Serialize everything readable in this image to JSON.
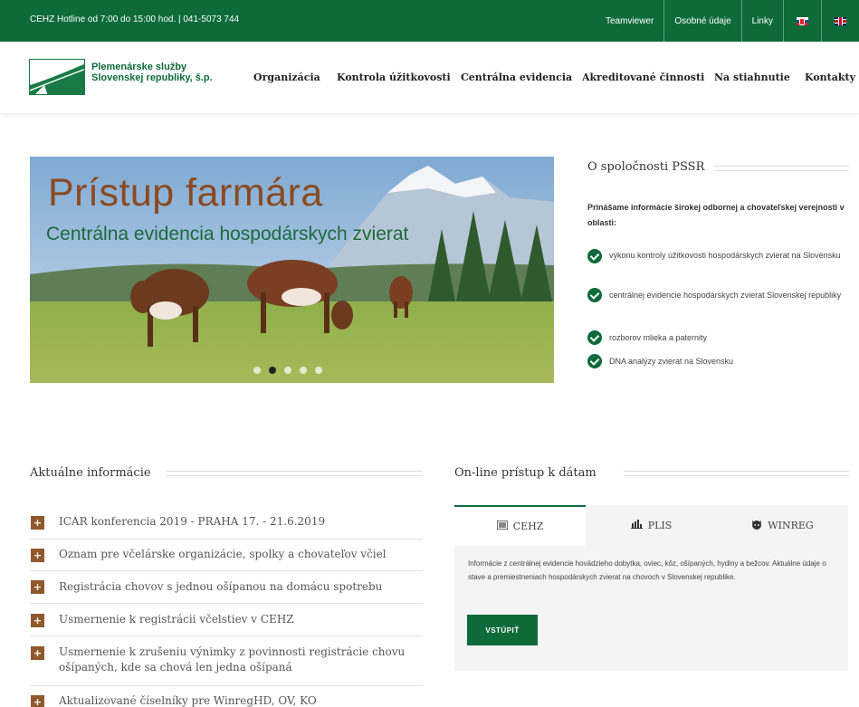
{
  "topbar": {
    "hotline": "CEHZ Hotline od 7:00 do 15:00 hod. | 041-5073 744",
    "links": [
      "Teamviewer",
      "Osobné údaje",
      "Linky"
    ],
    "flags": [
      "flag-sk-icon",
      "flag-gb-icon"
    ]
  },
  "header": {
    "logo_line1": "Plemenárske služby",
    "logo_line2": "Slovenskej republiky, š.p.",
    "nav": [
      "Organizácia",
      "Kontrola úžitkovosti",
      "Centrálna evidencia",
      "Akreditované činnosti",
      "Na stiahnutie",
      "Kontakty"
    ]
  },
  "slider": {
    "title": "Prístup farmára",
    "subtitle": "Centrálna evidencia hospodárskych zvierat",
    "slide_count": 5,
    "active_slide": 2
  },
  "about": {
    "title": "O spoločnosti PSSR",
    "lead": "Prinášame informácie širokej odbornej a chovateľskej verejnosti v oblasti:",
    "items": [
      "výkonu kontroly úžitkovosti hospodárskych zvierat na Slovensku",
      "centrálnej evidencie hospodárskych zvierat Slovenskej republiky",
      "rozborov mlieka a paternity",
      "DNA analýzy zvierat na Slovensku"
    ]
  },
  "news": {
    "title": "Aktuálne informácie",
    "items": [
      "ICAR konferencia 2019 - PRAHA 17. - 21.6.2019",
      "Oznam pre včelárske organizácie, spolky a chovateľov včiel",
      "Registrácia chovov s jednou ošípanou na domácu spotrebu",
      "Usmernenie k registrácii včelstiev v CEHZ",
      "Usmernenie k zrušeniu výnimky z povinnosti registrácie chovu ošípaných, kde sa chová len jedna ošípaná",
      "Aktualizované číselníky pre WinregHD, OV, KO"
    ]
  },
  "online": {
    "title": "On-line prístup k dátam",
    "tabs": [
      "CEHZ",
      "PLIS",
      "WINREG"
    ],
    "active_tab": 0,
    "text": "Informácie z centrálnej evidencie hovädzieho dobytka, oviec, kôz, ošípaných, hydiny a bežcov. Aktuálne údaje o stave a premiestneniach hospodárskych zvierat na chovoch v Slovenskej republike.",
    "button": "VSTÚPIŤ"
  },
  "colors": {
    "brand_green": "#0d6b3a",
    "accent_brown": "#8e5a2c",
    "hero_title": "#8a4a22"
  }
}
